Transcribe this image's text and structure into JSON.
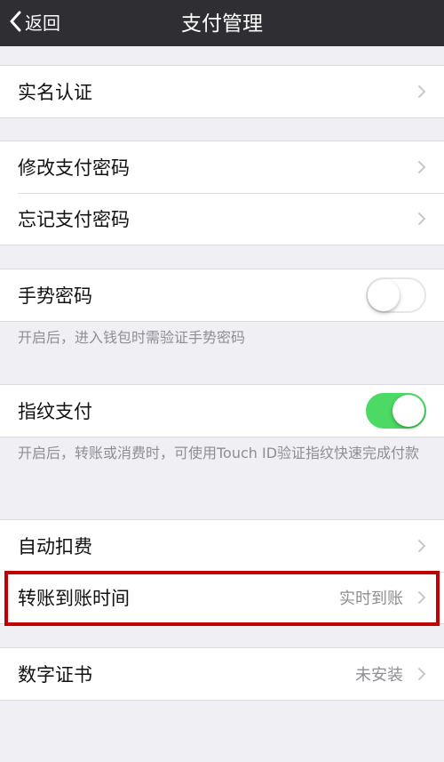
{
  "nav": {
    "back_label": "返回",
    "title": "支付管理"
  },
  "groups": {
    "realname": {
      "label": "实名认证"
    },
    "password": {
      "modify_label": "修改支付密码",
      "forgot_label": "忘记支付密码"
    },
    "gesture": {
      "label": "手势密码",
      "enabled": false,
      "footnote": "开启后，进入钱包时需验证手势密码"
    },
    "fingerprint": {
      "label": "指纹支付",
      "enabled": true,
      "footnote": "开启后，转账或消费时，可使用Touch ID验证指纹快速完成付款"
    },
    "deduct": {
      "auto_label": "自动扣费",
      "transfer_label": "转账到账时间",
      "transfer_value": "实时到账"
    },
    "cert": {
      "label": "数字证书",
      "value": "未安装"
    }
  },
  "icons": {
    "back": "chevron-left-icon",
    "disclosure": "chevron-right-icon"
  },
  "colors": {
    "nav_bg": "#2e2e33",
    "toggle_on": "#4cd964",
    "highlight": "#c00000",
    "background": "#efeff4"
  }
}
